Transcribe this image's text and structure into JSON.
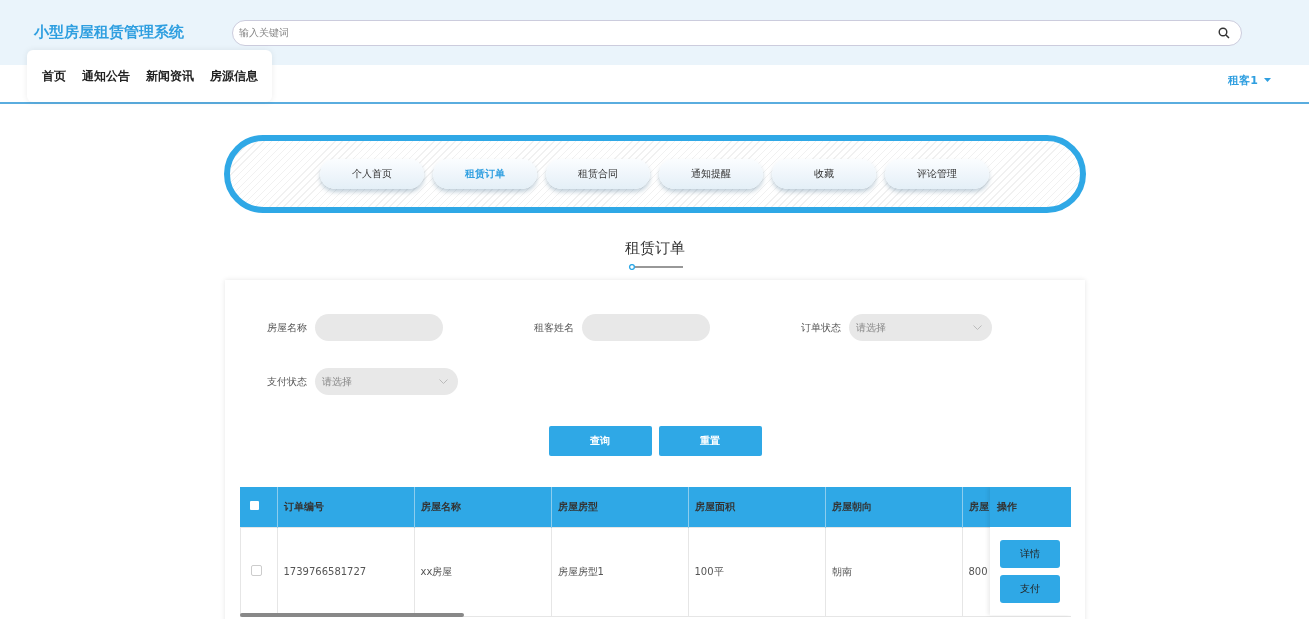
{
  "header": {
    "title": "小型房屋租赁管理系统",
    "search": {
      "placeholder": "输入关键词"
    }
  },
  "nav": {
    "items": [
      "首页",
      "通知公告",
      "新闻资讯",
      "房源信息"
    ],
    "user": "租客1"
  },
  "tabs": [
    {
      "label": "个人首页",
      "selected": false
    },
    {
      "label": "租赁订单",
      "selected": true
    },
    {
      "label": "租赁合同",
      "selected": false
    },
    {
      "label": "通知提醒",
      "selected": false
    },
    {
      "label": "收藏",
      "selected": false
    },
    {
      "label": "评论管理",
      "selected": false
    }
  ],
  "page_title": "租赁订单",
  "filters": [
    {
      "label": "房屋名称",
      "kind": "text"
    },
    {
      "label": "租客姓名",
      "kind": "text"
    },
    {
      "label": "订单状态",
      "kind": "select",
      "placeholder": "请选择"
    },
    {
      "label": "支付状态",
      "kind": "select",
      "placeholder": "请选择"
    }
  ],
  "buttons": [
    "查询",
    "重置"
  ],
  "table": {
    "select_all_checked": false,
    "columns": [
      "订单编号",
      "房屋名称",
      "房屋房型",
      "房屋面积",
      "房屋朝向",
      "房屋"
    ],
    "action_column": "操作",
    "rows": [
      {
        "checked": false,
        "cells": [
          "1739766581727",
          "xx房屋",
          "房屋房型1",
          "100平",
          "朝南",
          "800"
        ],
        "actions": [
          "详情",
          "支付"
        ]
      }
    ]
  }
}
